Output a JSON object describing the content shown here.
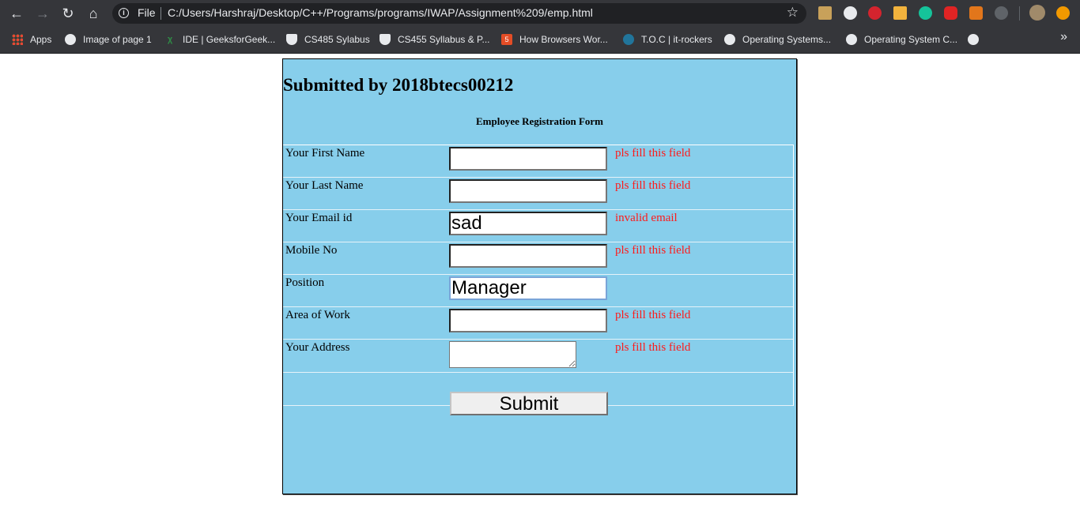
{
  "browser": {
    "omnibox": {
      "scheme_label": "File",
      "url": "C:/Users/Harshraj/Desktop/C++/Programs/programs/IWAP/Assignment%209/emp.html"
    },
    "bookmarks": [
      {
        "label": "Apps",
        "icon": "apps-grid-icon"
      },
      {
        "label": "Image of page 1",
        "icon": "globe-icon"
      },
      {
        "label": "IDE | GeeksforGeek...",
        "icon": "geeksforgeeks-icon"
      },
      {
        "label": "CS485 Sylabus",
        "icon": "shield-icon"
      },
      {
        "label": "CS455 Syllabus & P...",
        "icon": "shield-icon"
      },
      {
        "label": "How Browsers Wor...",
        "icon": "html5-icon"
      },
      {
        "label": "T.O.C | it-rockers",
        "icon": "wordpress-icon"
      },
      {
        "label": "Operating Systems...",
        "icon": "globe-icon"
      },
      {
        "label": "Operating System C...",
        "icon": "globe-icon"
      }
    ]
  },
  "page": {
    "heading": "Submitted by 2018btecs00212",
    "form_caption": "Employee Registration Form",
    "fields": [
      {
        "label": "Your First Name",
        "value": "",
        "error": "pls fill this field"
      },
      {
        "label": "Your Last Name",
        "value": "",
        "error": "pls fill this field"
      },
      {
        "label": "Your Email id",
        "value": "sad",
        "error": "invalid email"
      },
      {
        "label": "Mobile No",
        "value": "",
        "error": "pls fill this field"
      },
      {
        "label": "Position",
        "value": "Manager",
        "error": ""
      },
      {
        "label": "Area of Work",
        "value": "",
        "error": "pls fill this field"
      },
      {
        "label": "Your Address",
        "value": "",
        "error": "pls fill this field"
      }
    ],
    "submit_label": "Submit"
  },
  "colors": {
    "panel_background": "#87ceeb",
    "error_text": "#ff1a1a",
    "chrome_background": "#35363a"
  }
}
